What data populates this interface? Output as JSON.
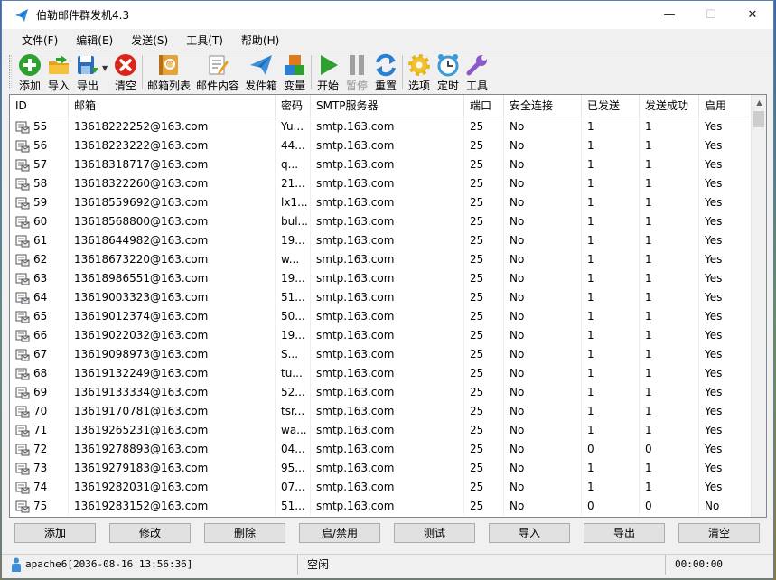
{
  "window": {
    "title": "伯勒邮件群发机4.3",
    "controls": {
      "minimize": "—",
      "maximize": "☐",
      "close": "✕"
    }
  },
  "menu": [
    "文件(F)",
    "编辑(E)",
    "发送(S)",
    "工具(T)",
    "帮助(H)"
  ],
  "toolbar": [
    {
      "name": "import",
      "label": "添加",
      "icon": "add-icon",
      "color": "#2ea02e"
    },
    {
      "name": "import-folder",
      "label": "导入",
      "icon": "folder-import-icon",
      "color": "#e8a21a"
    },
    {
      "name": "export",
      "label": "导出",
      "icon": "save-export-icon",
      "color": "#2a6fb6"
    },
    {
      "name": "clear",
      "label": "清空",
      "icon": "clear-icon",
      "color": "#d9261c"
    },
    {
      "name": "mailbox-list",
      "label": "邮箱列表",
      "icon": "address-book-icon",
      "color": "#e5a33a"
    },
    {
      "name": "mail-content",
      "label": "邮件内容",
      "icon": "document-edit-icon",
      "color": "#8a6b3a"
    },
    {
      "name": "sender",
      "label": "发件箱",
      "icon": "paper-plane-icon",
      "color": "#3a8fd8"
    },
    {
      "name": "variables",
      "label": "变量",
      "icon": "blocks-icon",
      "color": "#e07a1a"
    },
    {
      "name": "start",
      "label": "开始",
      "icon": "play-icon",
      "color": "#2ea02e"
    },
    {
      "name": "pause",
      "label": "暂停",
      "icon": "pause-icon",
      "color": "#a0a0a0"
    },
    {
      "name": "reset",
      "label": "重置",
      "icon": "refresh-icon",
      "color": "#2a7fd0"
    },
    {
      "name": "options",
      "label": "选项",
      "icon": "gear-icon",
      "color": "#e8b21a"
    },
    {
      "name": "timer",
      "label": "定时",
      "icon": "alarm-clock-icon",
      "color": "#3a9ad8"
    },
    {
      "name": "tools",
      "label": "工具",
      "icon": "wrench-icon",
      "color": "#8a5ac8"
    }
  ],
  "table": {
    "columns": [
      "ID",
      "邮箱",
      "密码",
      "SMTP服务器",
      "端口",
      "安全连接",
      "已发送",
      "发送成功",
      "启用"
    ],
    "rows": [
      [
        "55",
        "13618222252@163.com",
        "Yu...",
        "smtp.163.com",
        "25",
        "No",
        "1",
        "1",
        "Yes"
      ],
      [
        "56",
        "13618223222@163.com",
        "44...",
        "smtp.163.com",
        "25",
        "No",
        "1",
        "1",
        "Yes"
      ],
      [
        "57",
        "13618318717@163.com",
        "q...",
        "smtp.163.com",
        "25",
        "No",
        "1",
        "1",
        "Yes"
      ],
      [
        "58",
        "13618322260@163.com",
        "21...",
        "smtp.163.com",
        "25",
        "No",
        "1",
        "1",
        "Yes"
      ],
      [
        "59",
        "13618559692@163.com",
        "lx1...",
        "smtp.163.com",
        "25",
        "No",
        "1",
        "1",
        "Yes"
      ],
      [
        "60",
        "13618568800@163.com",
        "bul...",
        "smtp.163.com",
        "25",
        "No",
        "1",
        "1",
        "Yes"
      ],
      [
        "61",
        "13618644982@163.com",
        "19...",
        "smtp.163.com",
        "25",
        "No",
        "1",
        "1",
        "Yes"
      ],
      [
        "62",
        "13618673220@163.com",
        "w...",
        "smtp.163.com",
        "25",
        "No",
        "1",
        "1",
        "Yes"
      ],
      [
        "63",
        "13618986551@163.com",
        "19...",
        "smtp.163.com",
        "25",
        "No",
        "1",
        "1",
        "Yes"
      ],
      [
        "64",
        "13619003323@163.com",
        "51...",
        "smtp.163.com",
        "25",
        "No",
        "1",
        "1",
        "Yes"
      ],
      [
        "65",
        "13619012374@163.com",
        "50...",
        "smtp.163.com",
        "25",
        "No",
        "1",
        "1",
        "Yes"
      ],
      [
        "66",
        "13619022032@163.com",
        "19...",
        "smtp.163.com",
        "25",
        "No",
        "1",
        "1",
        "Yes"
      ],
      [
        "67",
        "13619098973@163.com",
        "S...",
        "smtp.163.com",
        "25",
        "No",
        "1",
        "1",
        "Yes"
      ],
      [
        "68",
        "13619132249@163.com",
        "tu...",
        "smtp.163.com",
        "25",
        "No",
        "1",
        "1",
        "Yes"
      ],
      [
        "69",
        "13619133334@163.com",
        "52...",
        "smtp.163.com",
        "25",
        "No",
        "1",
        "1",
        "Yes"
      ],
      [
        "70",
        "13619170781@163.com",
        "tsr...",
        "smtp.163.com",
        "25",
        "No",
        "1",
        "1",
        "Yes"
      ],
      [
        "71",
        "13619265231@163.com",
        "wa...",
        "smtp.163.com",
        "25",
        "No",
        "1",
        "1",
        "Yes"
      ],
      [
        "72",
        "13619278893@163.com",
        "04...",
        "smtp.163.com",
        "25",
        "No",
        "0",
        "0",
        "Yes"
      ],
      [
        "73",
        "13619279183@163.com",
        "95...",
        "smtp.163.com",
        "25",
        "No",
        "1",
        "1",
        "Yes"
      ],
      [
        "74",
        "13619282031@163.com",
        "07...",
        "smtp.163.com",
        "25",
        "No",
        "1",
        "1",
        "Yes"
      ],
      [
        "75",
        "13619283152@163.com",
        "51...",
        "smtp.163.com",
        "25",
        "No",
        "0",
        "0",
        "No"
      ]
    ]
  },
  "actions": [
    "添加",
    "修改",
    "删除",
    "启/禁用",
    "测试",
    "导入",
    "导出",
    "清空"
  ],
  "status": {
    "user": "apache6[2036-08-16 13:56:36]",
    "state": "空闲",
    "elapsed": "00:00:00"
  }
}
